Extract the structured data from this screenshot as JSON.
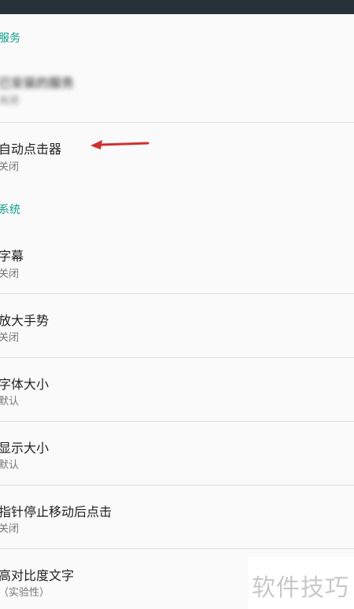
{
  "sections": {
    "services_title": "服务",
    "system_title": "系统"
  },
  "items": {
    "blurred_service": {
      "title": "已安装的服务",
      "summary": "关闭"
    },
    "auto_clicker": {
      "title": "自动点击器",
      "summary": "关闭"
    },
    "captions": {
      "title": "字幕",
      "summary": "关闭"
    },
    "magnification": {
      "title": "放大手势",
      "summary": "关闭"
    },
    "font_size": {
      "title": "字体大小",
      "summary": "默认"
    },
    "display_size": {
      "title": "显示大小",
      "summary": "默认"
    },
    "dwell_click": {
      "title": "指针停止移动后点击",
      "summary": "关闭"
    },
    "high_contrast_text": {
      "title": "高对比度文字",
      "summary": "（实验性）"
    }
  },
  "annotation": {
    "arrow_color": "#d32f2f"
  },
  "watermark": {
    "text": "软件技巧"
  },
  "colors": {
    "accent": "#0f9d8d",
    "status_bar": "#263238"
  }
}
